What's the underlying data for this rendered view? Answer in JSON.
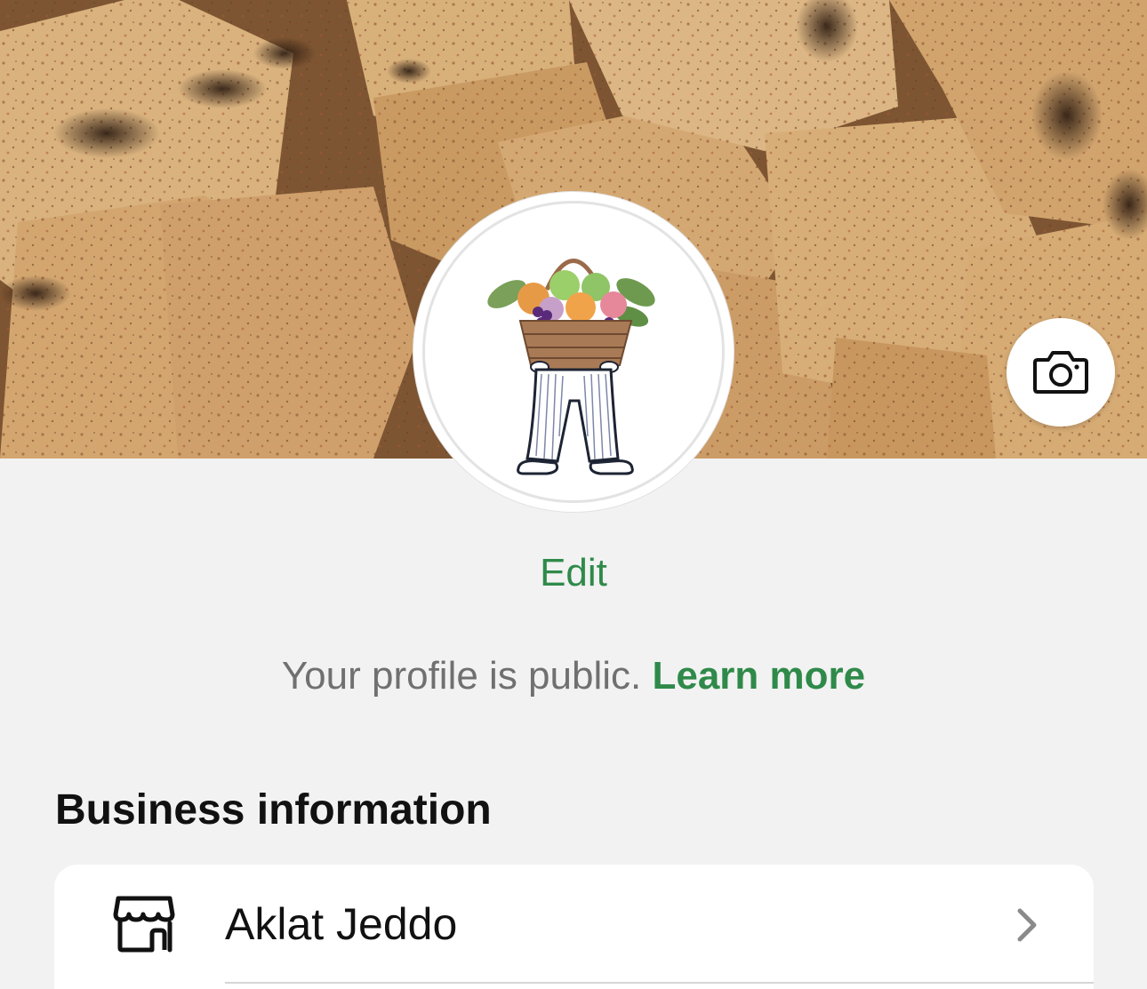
{
  "cover": {
    "description_icon": "cover-photo",
    "camera_icon": "camera-icon"
  },
  "profile": {
    "avatar_icon": "fruit-basket-logo",
    "edit_label": "Edit",
    "public_note": "Your profile is public.",
    "learn_more_label": "Learn more"
  },
  "business_information": {
    "title": "Business information",
    "items": [
      {
        "icon": "store-icon",
        "label": "Aklat Jeddo",
        "chevron": "chevron-right-icon"
      }
    ]
  },
  "colors": {
    "accent": "#2f8a4a",
    "background": "#f2f2f2",
    "card": "#ffffff",
    "secondary_text": "#707070"
  }
}
